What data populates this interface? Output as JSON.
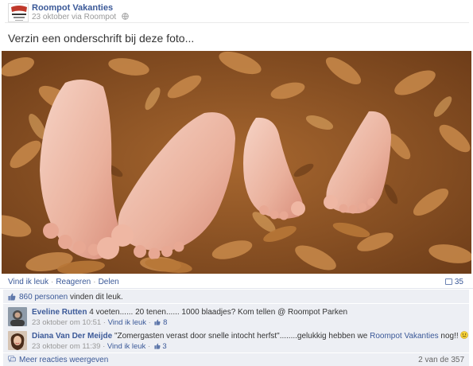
{
  "post": {
    "page_name": "Roompot Vakanties",
    "date": "23 oktober",
    "via": "via Roompot",
    "caption": "Verzin een onderschrift bij deze foto..."
  },
  "actions": {
    "like": "Vind ik leuk",
    "comment": "Reageren",
    "share": "Delen",
    "comment_count": "35"
  },
  "likes": {
    "count_link": "860 personen",
    "suffix": "vinden dit leuk."
  },
  "comments": [
    {
      "author": "Eveline Rutten",
      "text": "4 voeten...... 20 tenen...... 1000 blaadjes? Kom tellen @ Roompot Parken",
      "timestamp": "23 oktober om 10:51",
      "like_label": "Vind ik leuk",
      "like_count": "8"
    },
    {
      "author": "Diana Van Der Meijde",
      "text_before": "\"Zomergasten verast door snelle intocht herfst\"........gelukkig hebben we",
      "text_link": "Roompot Vakanties",
      "text_after": "nog!!",
      "timestamp": "23 oktober om 11:39",
      "like_label": "Vind ik leuk",
      "like_count": "3"
    }
  ],
  "more_comments": {
    "label": "Meer reacties weergeven",
    "pager": "2 van de 357"
  },
  "icons": {
    "globe": "globe-icon",
    "comment": "comment-icon",
    "like": "thumbs-up-icon",
    "more": "comments-icon",
    "smiley": "smiley-icon"
  },
  "colors": {
    "link": "#3b5998",
    "ufi_bg": "#edeff4",
    "meta": "#999999"
  }
}
